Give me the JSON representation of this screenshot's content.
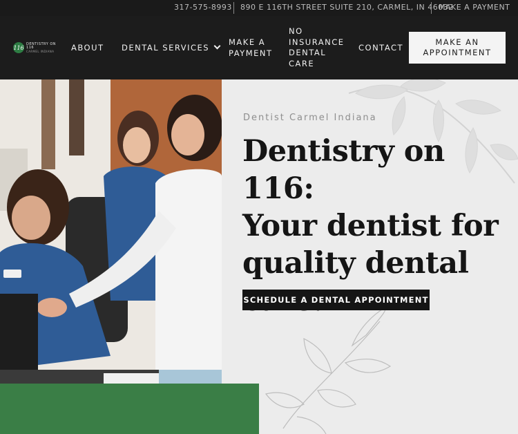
{
  "topbar": {
    "phone": "317-575-8993",
    "address": "890 E 116TH STREET SUITE 210, CARMEL, IN 46032",
    "payment_link": "MAKE A PAYMENT"
  },
  "logo": {
    "mark": "116",
    "line1": "DENTISTRY ON 116",
    "line2": "CARMEL INDIANA"
  },
  "nav": {
    "about": "ABOUT",
    "dental_services": "DENTAL SERVICES",
    "make_payment_1": "MAKE A",
    "make_payment_2": "PAYMENT",
    "no_insurance_1": "NO",
    "no_insurance_2": "INSURANCE",
    "no_insurance_3": "DENTAL",
    "no_insurance_4": "CARE",
    "contact": "CONTACT",
    "cta_1": "MAKE AN",
    "cta_2": "APPOINTMENT"
  },
  "hero": {
    "eyebrow": "Dentist Carmel Indiana",
    "headline_1": "Dentistry on 116:",
    "headline_2": "Your dentist for",
    "headline_3": "quality dental",
    "headline_4": "care.",
    "button": "SCHEDULE A DENTAL APPOINTMENT"
  },
  "colors": {
    "dark": "#1c1c1c",
    "accent_green": "#3a7e46",
    "hero_bg": "#ececec"
  }
}
